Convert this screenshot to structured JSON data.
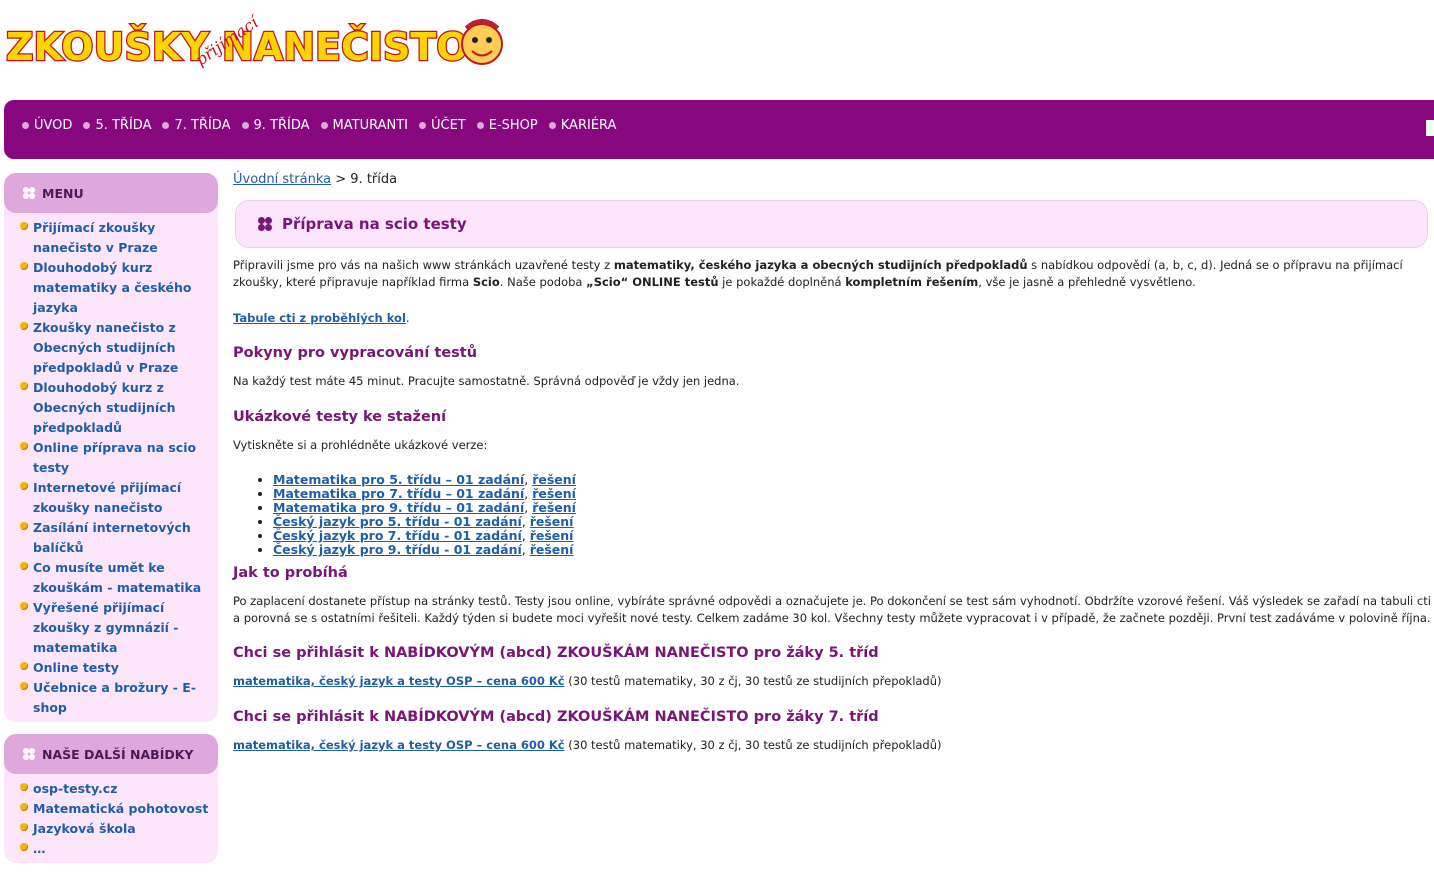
{
  "logo": {
    "text": "ZKOUŠKY NANEČISTO",
    "tagline": "přijímací"
  },
  "nav": {
    "items": [
      "ÚVOD",
      "5. TŘÍDA",
      "7. TŘÍDA",
      "9. TŘÍDA",
      "MATURANTI",
      "ÚČET",
      "E-SHOP",
      "KARIÉRA"
    ],
    "bullet_color": "#e0a8dc",
    "bg_color": "#87077e"
  },
  "sidebar": {
    "menu_title": "MENU",
    "menu_items": [
      "Přijímací zkoušky nanečisto v Praze",
      "Dlouhodobý kurz matematiky a českého jazyka",
      "Zkoušky nanečisto z Obecných studijních předpokladů v Praze",
      "Dlouhodobý kurz z Obecných studijních předpokladů",
      "Online příprava na scio testy",
      "Internetové přijímací zkoušky nanečisto",
      "Zasílání internetových balíčků",
      "Co musíte umět ke zkouškám - matematika",
      "Vyřešené přijímací zkoušky z gymnázií - matematika",
      "Online testy",
      "Učebnice a brožury - E-shop"
    ],
    "offers_title": "NAŠE DALŠÍ NABÍDKY",
    "offers_items": [
      "osp-testy.cz",
      "Matematická pohotovost",
      "Jazyková škola",
      "…"
    ]
  },
  "breadcrumb": {
    "home": "Úvodní stránka",
    "sep": ">",
    "current": "9. třída"
  },
  "page_title": "Příprava na scio testy",
  "intro": {
    "p1_a": "Připravili jsme pro vás na našich www stránkách uzavřené testy z ",
    "p1_b": "matematiky, českého jazyka a obecných studijních předpokladů",
    "p1_c": " s nabídkou odpovědí (a, b, c, d). Jedná se o přípravu na přijímací zkoušky, které připravuje například firma ",
    "p1_d": "Scio",
    "p1_e": ". Naše podoba ",
    "p1_f": "„Scio“ ONLINE testů",
    "p1_g": " je pokaždé doplněná ",
    "p1_h": "kompletním řešením",
    "p1_i": ", vše je jasně a přehledně vysvětleno.",
    "tabule_link": "Tabule cti z proběhlých kol",
    "tabule_dot": "."
  },
  "instructions": {
    "heading": "Pokyny pro vypracování testů",
    "text": "Na každý test máte 45 minut. Pracujte samostatně. Správná odpověď je vždy jen jedna."
  },
  "samples": {
    "heading": "Ukázkové testy ke stažení",
    "text": "Vytiskněte si a prohlédněte ukázkové verze:",
    "items": [
      {
        "test": "Matematika pro 5. třídu – 01 zadání",
        "solution": "řešení"
      },
      {
        "test": "Matematika pro 7. třídu – 01 zadání",
        "solution": "řešení"
      },
      {
        "test": "Matematika pro 9. třídu – 01 zadání",
        "solution": "řešení"
      },
      {
        "test": "Český jazyk pro 5. třídu - 01 zadání",
        "solution": "řešení"
      },
      {
        "test": "Český jazyk pro 7. třídu - 01 zadání",
        "solution": "řešení"
      },
      {
        "test": "Český jazyk pro 9. třídu - 01 zadání",
        "solution": "řešení"
      }
    ]
  },
  "howto": {
    "heading": "Jak to probíhá",
    "text": "Po zaplacení dostanete přístup na stránky testů. Testy jsou online, vybíráte správné odpovědi a označujete je. Po dokončení se test sám vyhodnotí. Obdržíte vzorové řešení. Váš výsledek se zařadí na tabuli cti a porovná se s ostatními řešiteli. Každý týden si budete moci vyřešit nové testy. Celkem zadáme 30 kol. Všechny testy můžete vypracovat i v případě, že začnete později. První test zadáváme v polovině října."
  },
  "signup5": {
    "heading": "Chci se přihlásit k NABÍDKOVÝM (abcd) ZKOUŠKÁM NANEČISTO pro žáky 5. tříd",
    "link": "matematika, český jazyk a testy OSP – cena 600 Kč",
    "note": " (30 testů matematiky, 30 z čj, 30 testů ze studijních přepokladů)"
  },
  "signup7": {
    "heading": "Chci se přihlásit k NABÍDKOVÝM (abcd) ZKOUŠKÁM NANEČISTO pro žáky 7. tříd",
    "link": "matematika, český jazyk a testy OSP – cena 600 Kč",
    "note": " (30 testů matematiky, 30 z čj, 30 testů ze studijních přepokladů)"
  },
  "colors": {
    "accent": "#87077e",
    "heading": "#7a1477",
    "panel": "#fde6fb",
    "panel_head": "#dfa8dc",
    "link": "#1f5fa8"
  }
}
